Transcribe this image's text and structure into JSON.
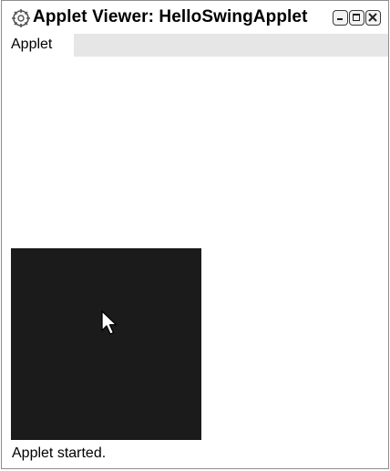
{
  "window": {
    "title": "Applet Viewer: HelloSwingApplet",
    "icon": "applet-viewer-icon",
    "controls": {
      "minimize": "minimize-icon",
      "maximize": "maximize-icon",
      "close": "close-icon"
    }
  },
  "menubar": {
    "items": [
      {
        "label": "Applet"
      }
    ]
  },
  "applet": {
    "panel_color": "#1b1b1b",
    "cursor": "arrow-cursor-icon"
  },
  "status": {
    "text": "Applet started."
  }
}
